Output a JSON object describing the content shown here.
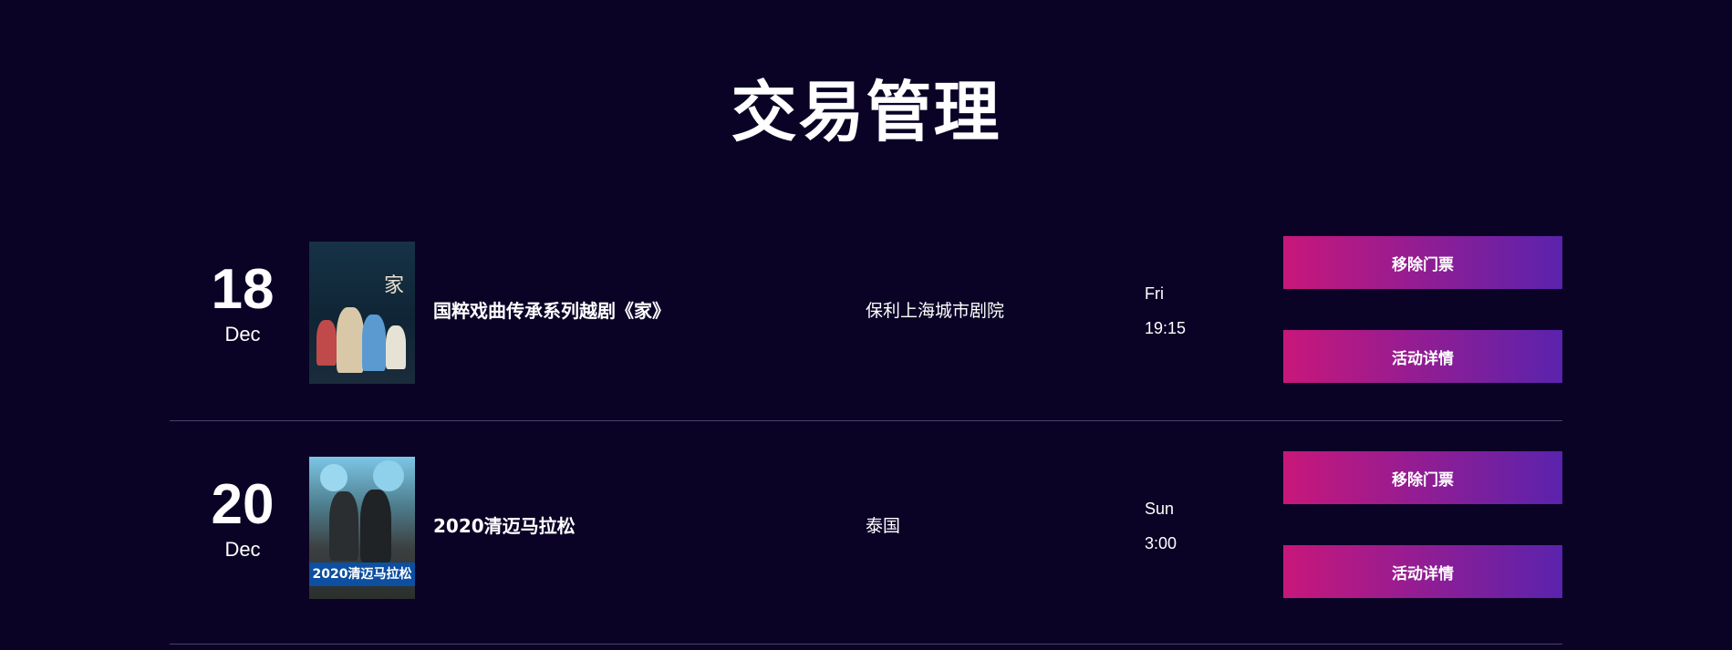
{
  "page": {
    "title": "交易管理"
  },
  "events": [
    {
      "day": "18",
      "month": "Dec",
      "name": "国粹戏曲传承系列越剧《家》",
      "venue": "保利上海城市剧院",
      "weekday": "Fri",
      "time": "19:15",
      "poster_glyph": "家",
      "poster_banner": "",
      "remove_label": "移除门票",
      "detail_label": "活动详情"
    },
    {
      "day": "20",
      "month": "Dec",
      "name": "2020清迈马拉松",
      "venue": "泰国",
      "weekday": "Sun",
      "time": "3:00",
      "poster_glyph": "",
      "poster_banner": "2020清迈马拉松",
      "remove_label": "移除门票",
      "detail_label": "活动详情"
    }
  ],
  "colors": {
    "background": "#0b0326",
    "button_gradient_start": "#c8177a",
    "button_gradient_end": "#5a23ad",
    "divider": "#4a4068"
  }
}
